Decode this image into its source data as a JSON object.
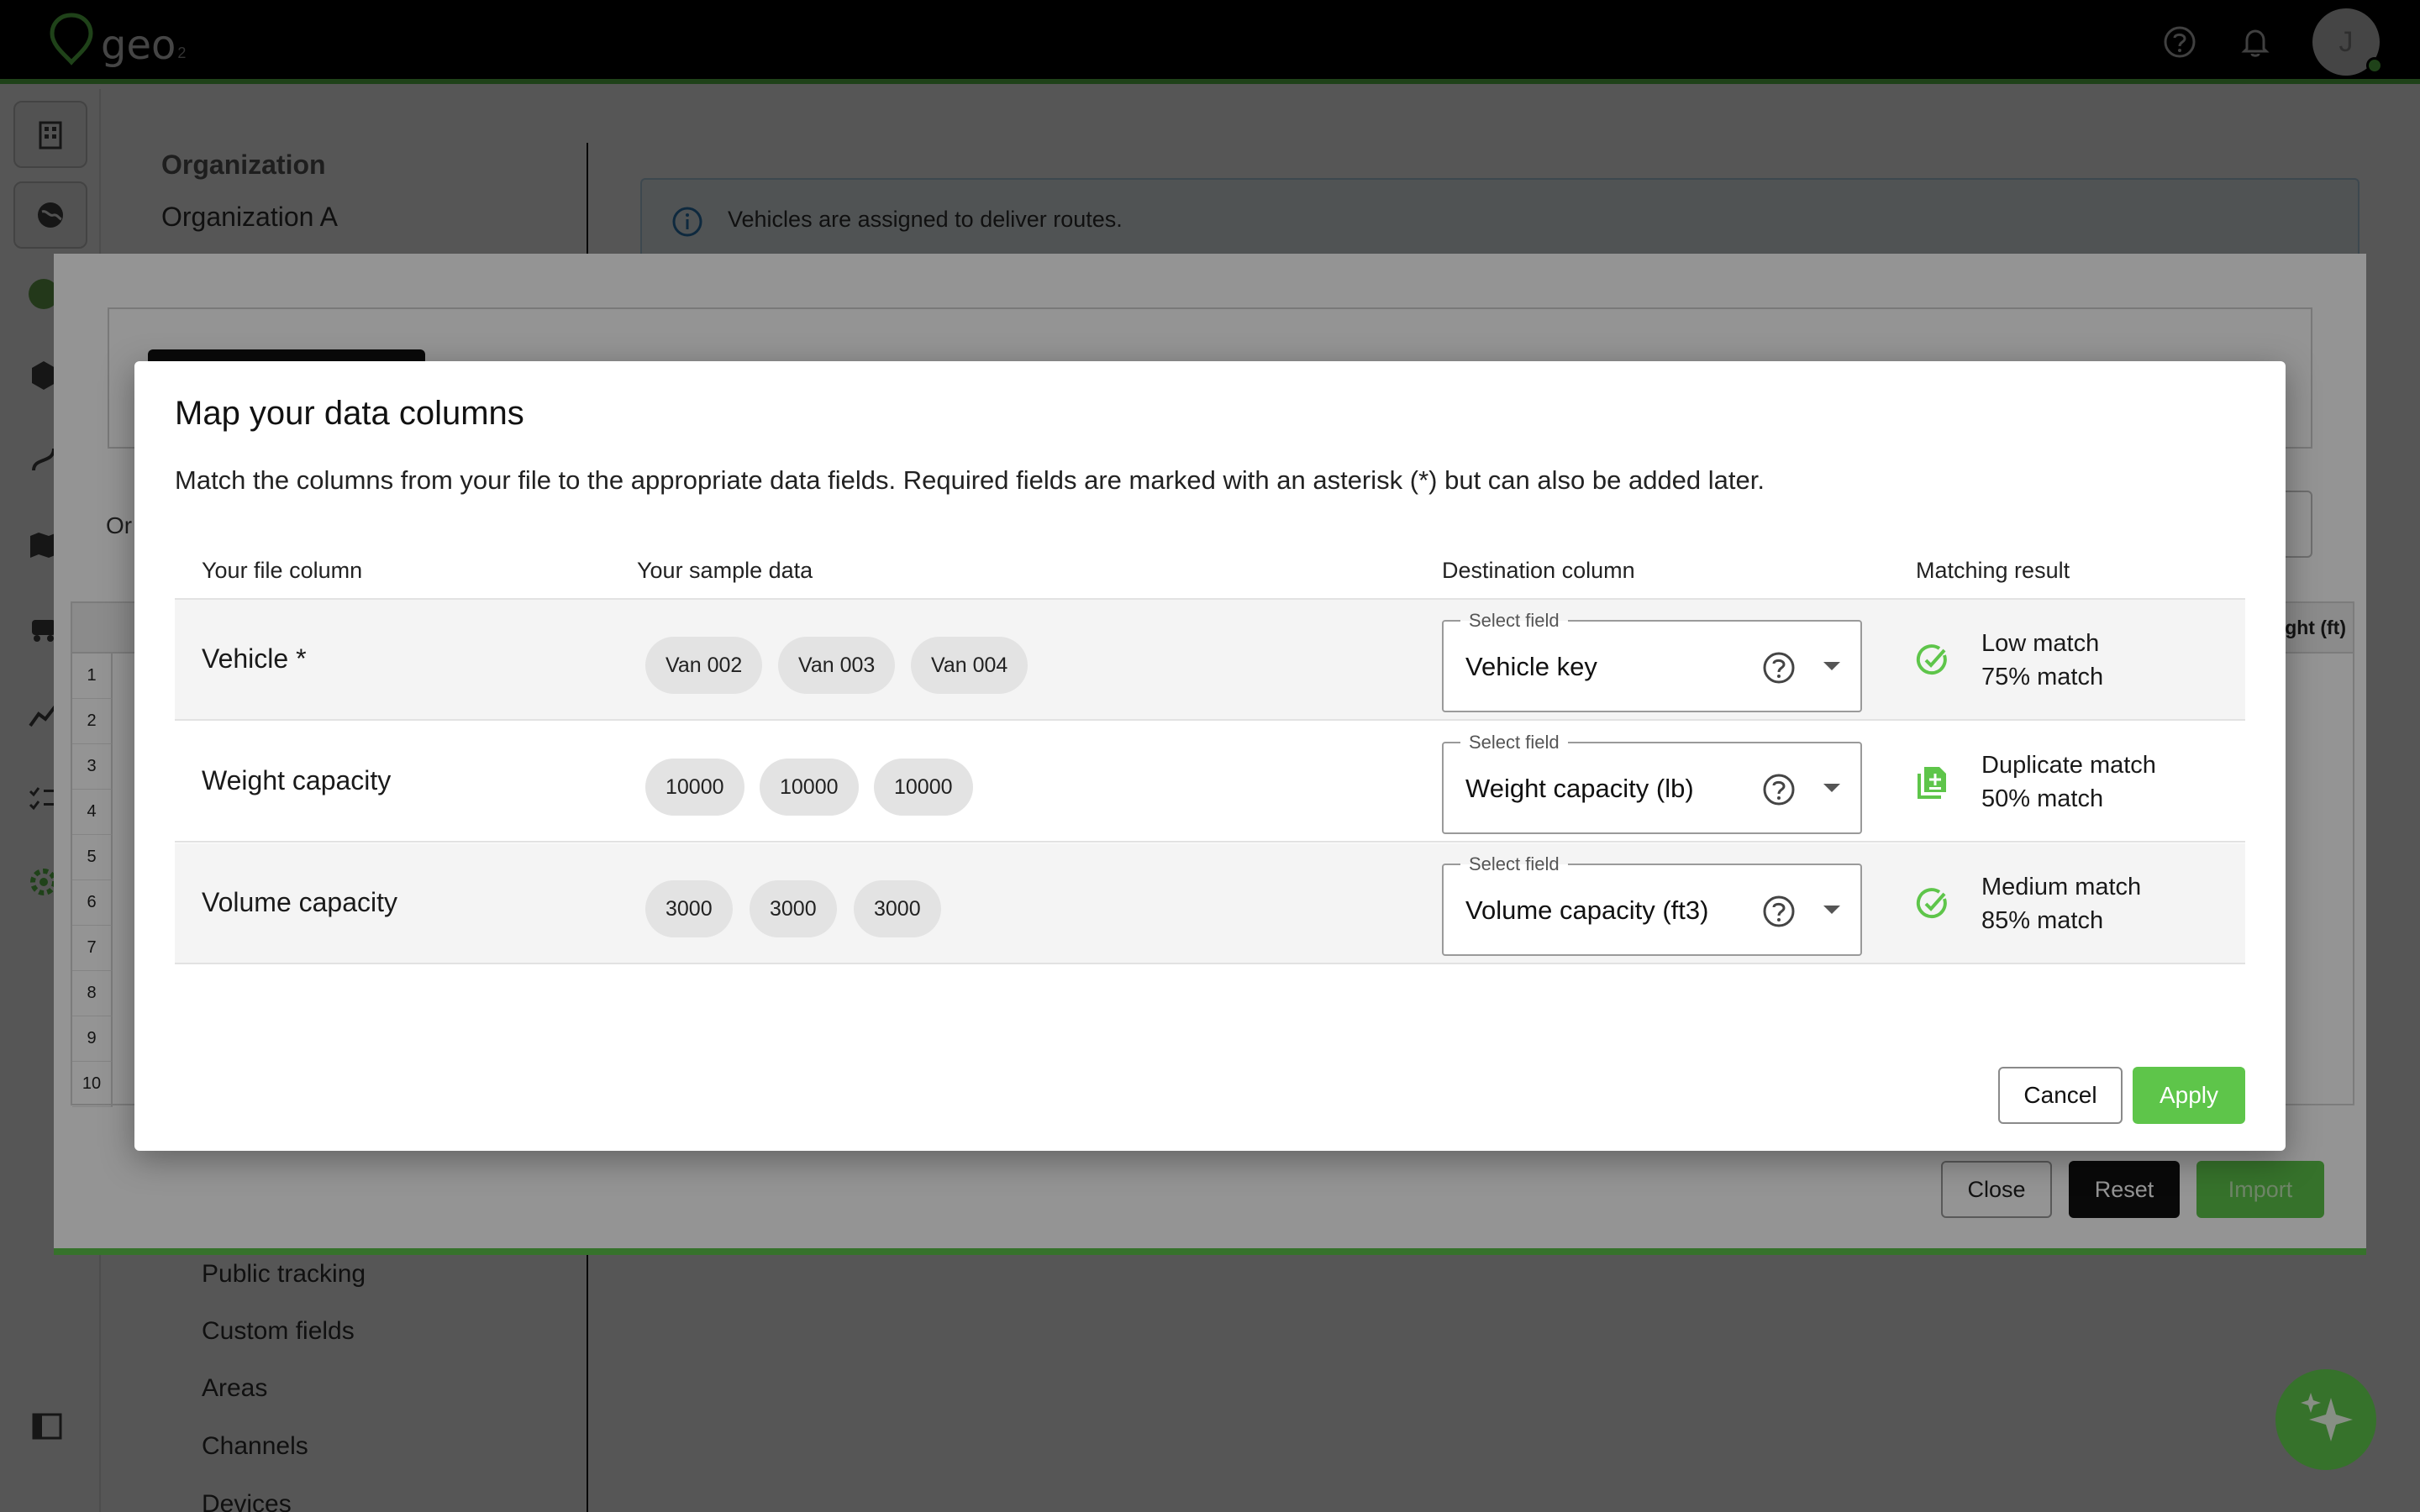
{
  "app": {
    "logo_text": "geo",
    "logo_sub": "2",
    "avatar_initial": "J"
  },
  "org_panel": {
    "heading": "Organization",
    "name": "Organization A",
    "links": [
      "Public tracking",
      "Custom fields",
      "Areas",
      "Channels",
      "Devices"
    ]
  },
  "info_banner": {
    "text": "Vehicles are assigned to deliver routes."
  },
  "bg_modal": {
    "label_partial": "Or",
    "grid_header_partial": "ght (ft)",
    "row_numbers": [
      "1",
      "2",
      "3",
      "4",
      "5",
      "6",
      "7",
      "8",
      "9",
      "10"
    ],
    "close_label": "Close",
    "reset_label": "Reset",
    "import_label": "Import"
  },
  "dialog": {
    "title": "Map your data columns",
    "description": "Match the columns from your file to the appropriate data fields. Required fields are marked with an asterisk (*) but can also be added later.",
    "columns": {
      "file_column": "Your file column",
      "sample_data": "Your sample data",
      "destination": "Destination column",
      "result": "Matching result"
    },
    "select_legend": "Select field",
    "rows": [
      {
        "file_column": "Vehicle *",
        "samples": [
          "Van 002",
          "Van 003",
          "Van 004"
        ],
        "destination": "Vehicle key",
        "match_icon": "check-circle-icon",
        "match_name": "Low match",
        "match_pct": "75% match"
      },
      {
        "file_column": "Weight capacity",
        "samples": [
          "10000",
          "10000",
          "10000"
        ],
        "destination": "Weight capacity (lb)",
        "match_icon": "duplicate-file-icon",
        "match_name": "Duplicate match",
        "match_pct": "50% match"
      },
      {
        "file_column": "Volume capacity",
        "samples": [
          "3000",
          "3000",
          "3000"
        ],
        "destination": "Volume capacity (ft3)",
        "match_icon": "check-circle-icon",
        "match_name": "Medium match",
        "match_pct": "85% match"
      }
    ],
    "cancel_label": "Cancel",
    "apply_label": "Apply"
  },
  "colors": {
    "brand_green": "#5ec54a",
    "topbar": "#000000"
  }
}
